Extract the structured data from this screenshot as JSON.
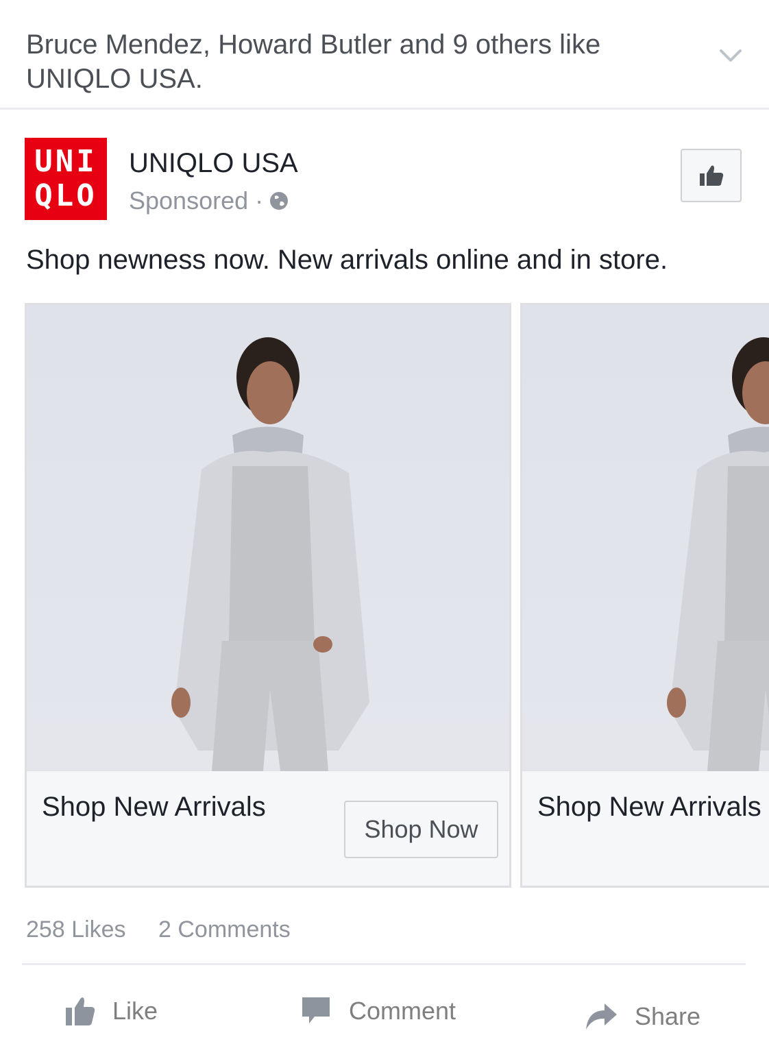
{
  "social_context": {
    "text": "Bruce Mendez, Howard Butler and 9 others like UNIQLO USA."
  },
  "post": {
    "logo_line1": "UNI",
    "logo_line2": "QLO",
    "page_name": "UNIQLO USA",
    "sponsored": "Sponsored",
    "separator": "·",
    "text": "Shop newness now. New arrivals online and in store."
  },
  "carousel": [
    {
      "title": "Shop New Arrivals",
      "cta": "Shop Now"
    },
    {
      "title": "Shop New Arrivals"
    }
  ],
  "stats": {
    "likes": "258 Likes",
    "comments": "2 Comments"
  },
  "actions": {
    "like": "Like",
    "comment": "Comment",
    "share": "Share"
  },
  "colors": {
    "brand_red": "#e60012",
    "muted_text": "#90949c",
    "action_gray": "#7f7f7f"
  },
  "icons": [
    "chevron-down-icon",
    "globe-icon",
    "thumbs-up-icon",
    "comment-icon",
    "share-icon"
  ]
}
